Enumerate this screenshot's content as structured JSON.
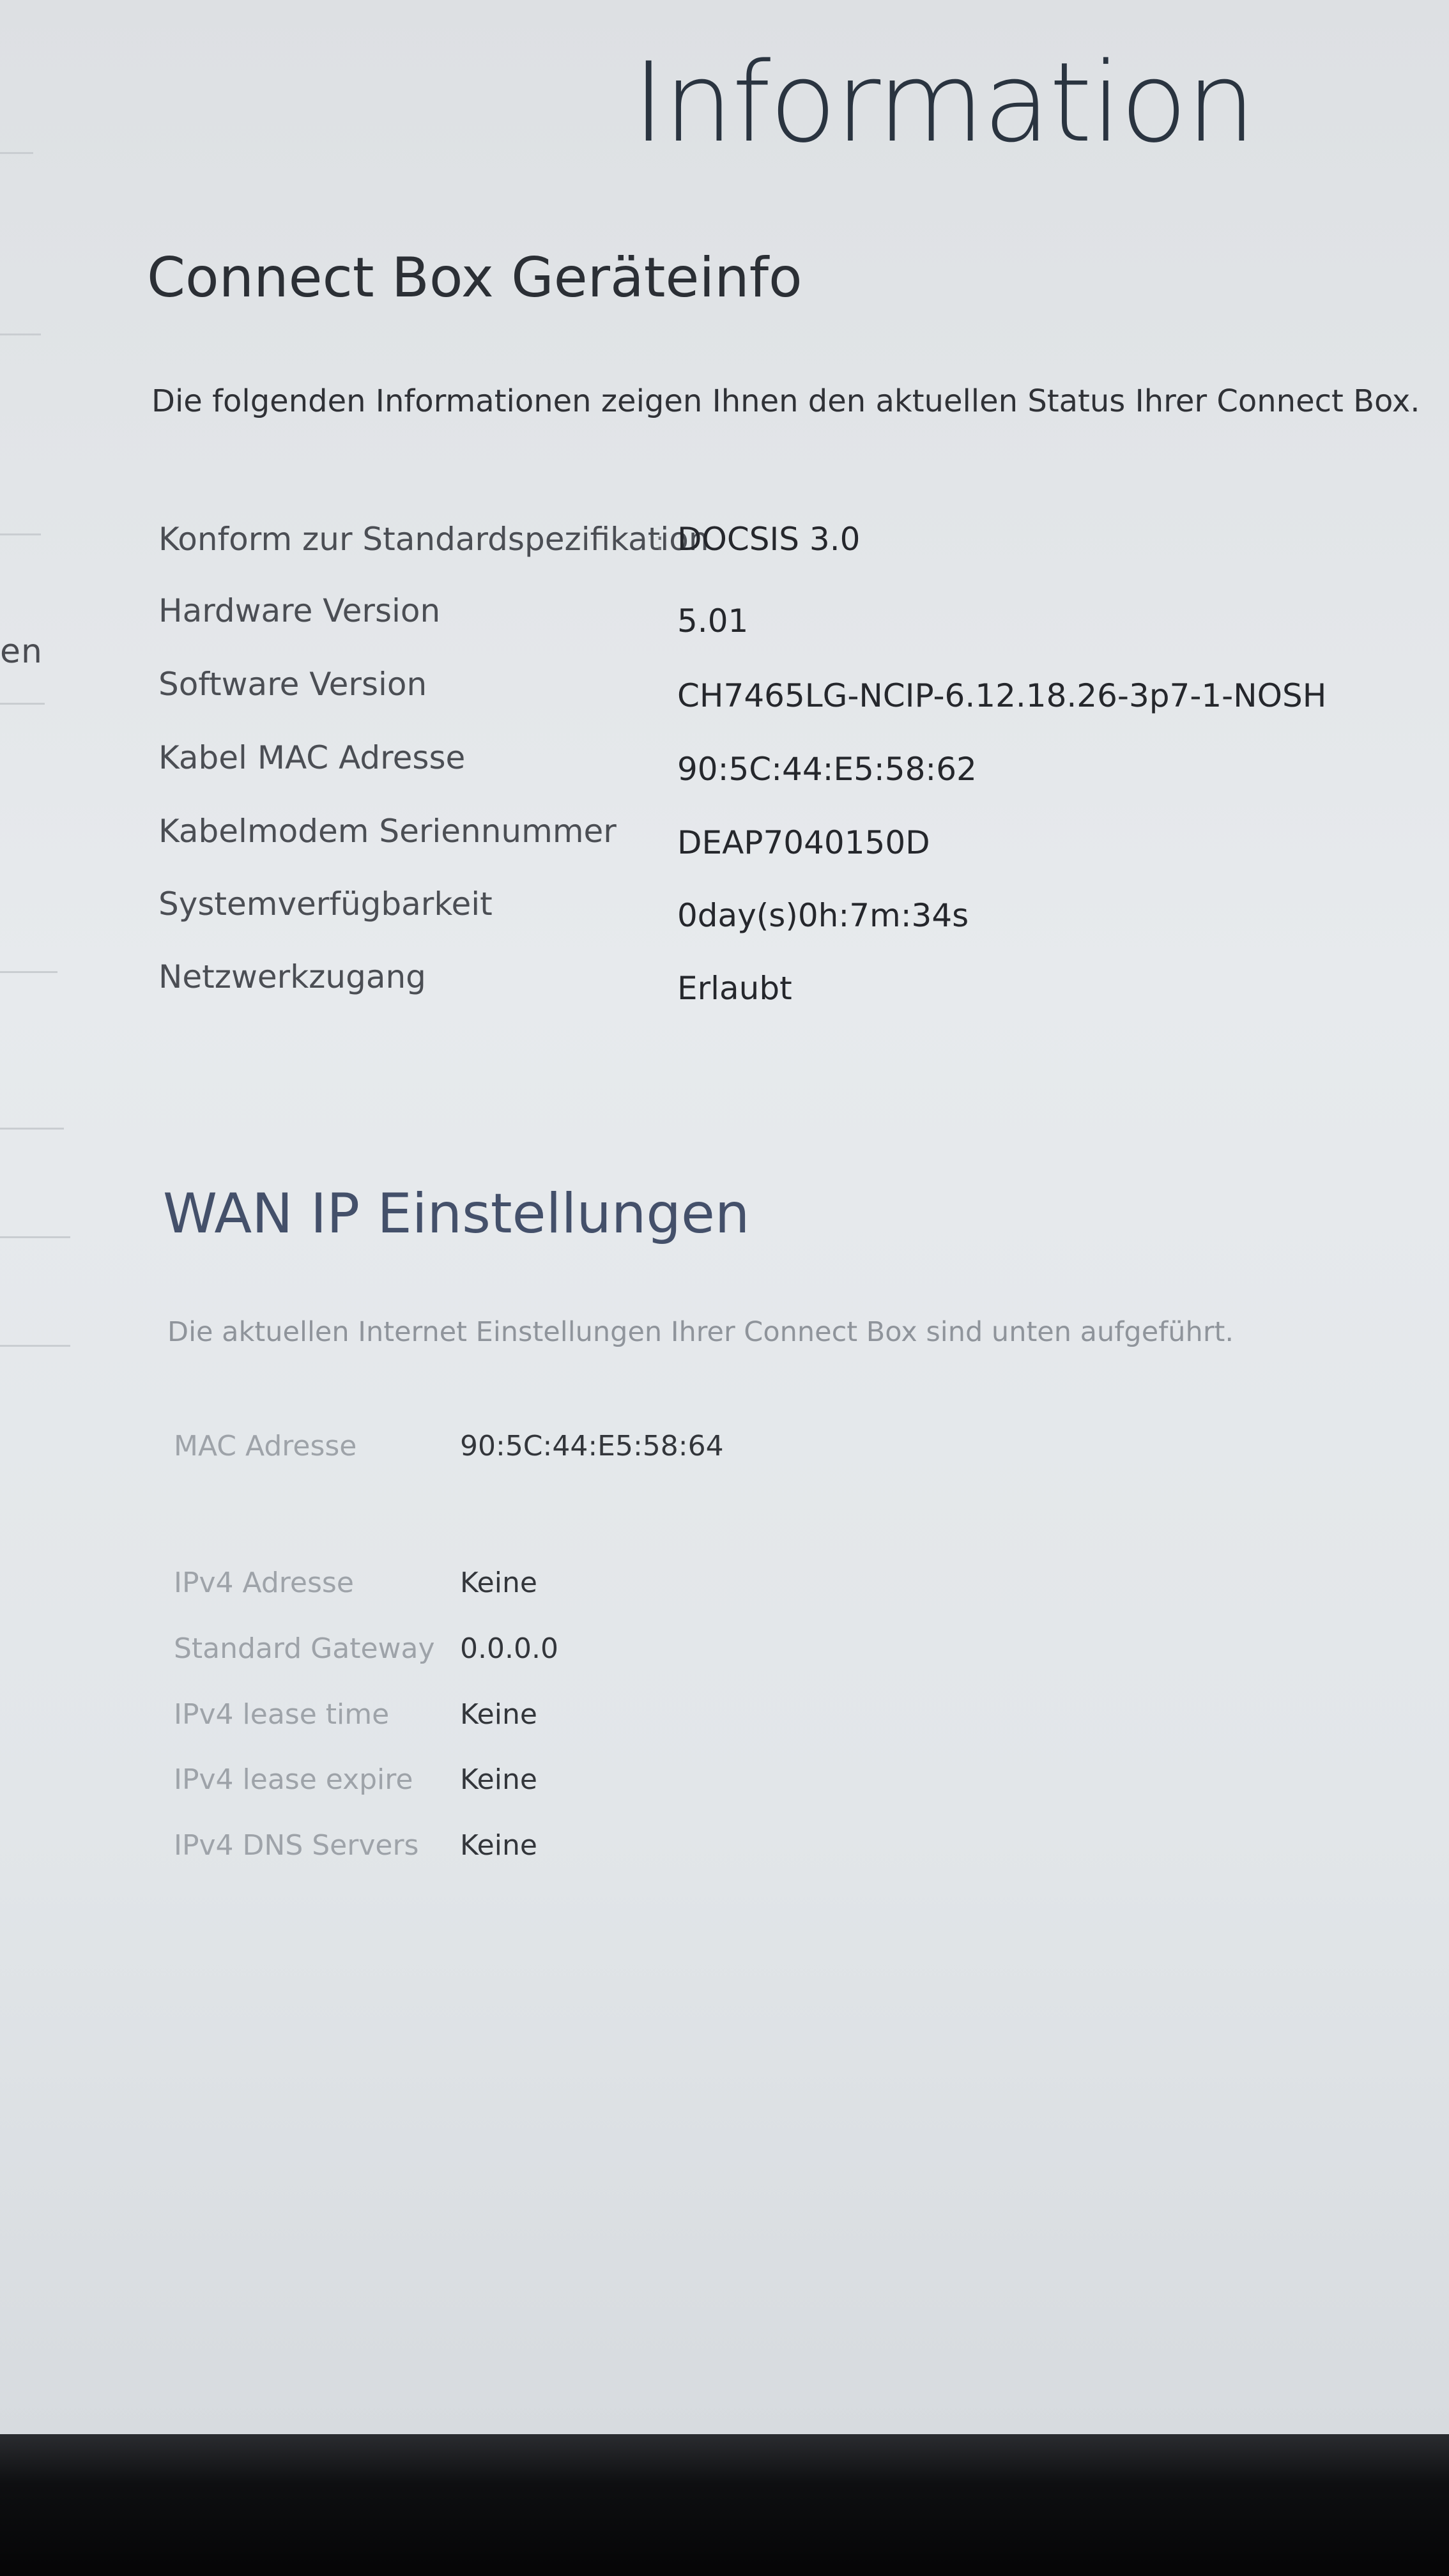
{
  "sidebar": {
    "partial_text": "en"
  },
  "page_title": "Information",
  "device_info": {
    "title": "Connect Box Geräteinfo",
    "intro": "Die folgenden Informationen zeigen Ihnen den aktuellen Status Ihrer Connect Box.",
    "rows": [
      {
        "label": "Konform zur Standardspezifikation",
        "value": "DOCSIS 3.0"
      },
      {
        "label": "Hardware Version",
        "value": "5.01"
      },
      {
        "label": "Software Version",
        "value": "CH7465LG-NCIP-6.12.18.26-3p7-1-NOSH"
      },
      {
        "label": "Kabel MAC Adresse",
        "value": "90:5C:44:E5:58:62"
      },
      {
        "label": "Kabelmodem Seriennummer",
        "value": "DEAP7040150D"
      },
      {
        "label": "Systemverfügbarkeit",
        "value": "0day(s)0h:7m:34s"
      },
      {
        "label": "Netzwerkzugang",
        "value": "Erlaubt"
      }
    ]
  },
  "wan_settings": {
    "title": "WAN IP Einstellungen",
    "intro": "Die aktuellen Internet Einstellungen Ihrer Connect Box sind unten aufgeführt.",
    "mac": {
      "label": "MAC Adresse",
      "value": "90:5C:44:E5:58:64"
    },
    "rows": [
      {
        "label": "IPv4 Adresse",
        "value": "Keine"
      },
      {
        "label": "Standard Gateway",
        "value": "0.0.0.0"
      },
      {
        "label": "IPv4 lease time",
        "value": "Keine"
      },
      {
        "label": "IPv4 lease expire",
        "value": "Keine"
      },
      {
        "label": "IPv4 DNS Servers",
        "value": "Keine"
      }
    ]
  }
}
